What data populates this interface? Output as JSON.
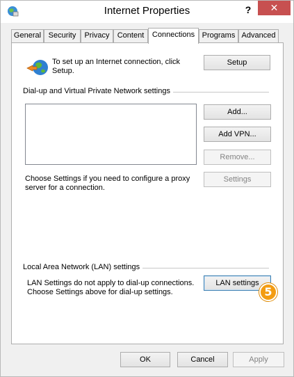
{
  "window": {
    "title": "Internet Properties",
    "help_glyph": "?",
    "close_glyph": "✕"
  },
  "tabs": [
    {
      "label": "General"
    },
    {
      "label": "Security"
    },
    {
      "label": "Privacy"
    },
    {
      "label": "Content"
    },
    {
      "label": "Connections",
      "active": true
    },
    {
      "label": "Programs"
    },
    {
      "label": "Advanced"
    }
  ],
  "setup": {
    "text_line1": "To set up an Internet connection, click",
    "text_line2": "Setup.",
    "button": "Setup"
  },
  "dialup": {
    "group_label": "Dial-up and Virtual Private Network settings",
    "add_button": "Add...",
    "add_vpn_button": "Add VPN...",
    "remove_button": "Remove...",
    "settings_button": "Settings",
    "proxy_text_line1": "Choose Settings if you need to configure a proxy",
    "proxy_text_line2": "server for a connection."
  },
  "lan": {
    "group_label": "Local Area Network (LAN) settings",
    "text_line1": "LAN Settings do not apply to dial-up connections.",
    "text_line2": "Choose Settings above for dial-up settings.",
    "button": "LAN settings"
  },
  "step_badge": "5",
  "footer": {
    "ok": "OK",
    "cancel": "Cancel",
    "apply": "Apply"
  },
  "colors": {
    "close_button": "#c75050",
    "badge": "#f39c12"
  }
}
